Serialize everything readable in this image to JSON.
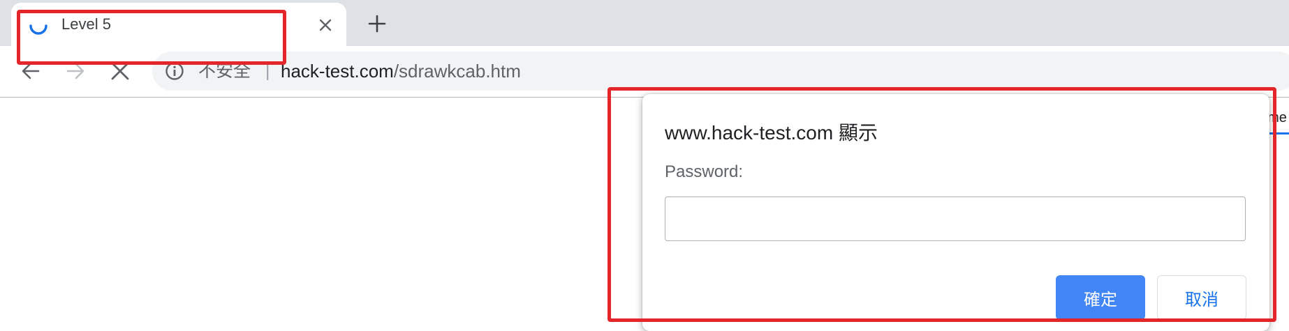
{
  "browser": {
    "tab": {
      "title": "Level 5",
      "spinner_icon": "loading-spinner-icon",
      "close_icon": "close-icon"
    },
    "new_tab_icon": "plus-icon",
    "toolbar": {
      "back_icon": "arrow-left-icon",
      "forward_icon": "arrow-right-icon",
      "stop_icon": "close-icon"
    },
    "omnibox": {
      "info_icon": "info-icon",
      "security_label": "不安全",
      "divider": "|",
      "url_host": "hack-test.com",
      "url_path": "/sdrawkcab.htm"
    }
  },
  "page": {
    "edge_fragment": "eme"
  },
  "dialog": {
    "title": "www.hack-test.com 顯示",
    "label": "Password:",
    "input_value": "",
    "ok_label": "確定",
    "cancel_label": "取消"
  },
  "colors": {
    "annotation": "#e4262a",
    "accent": "#4285f4",
    "spinner": "#1a73e8",
    "tabstrip": "#dee1e6"
  }
}
